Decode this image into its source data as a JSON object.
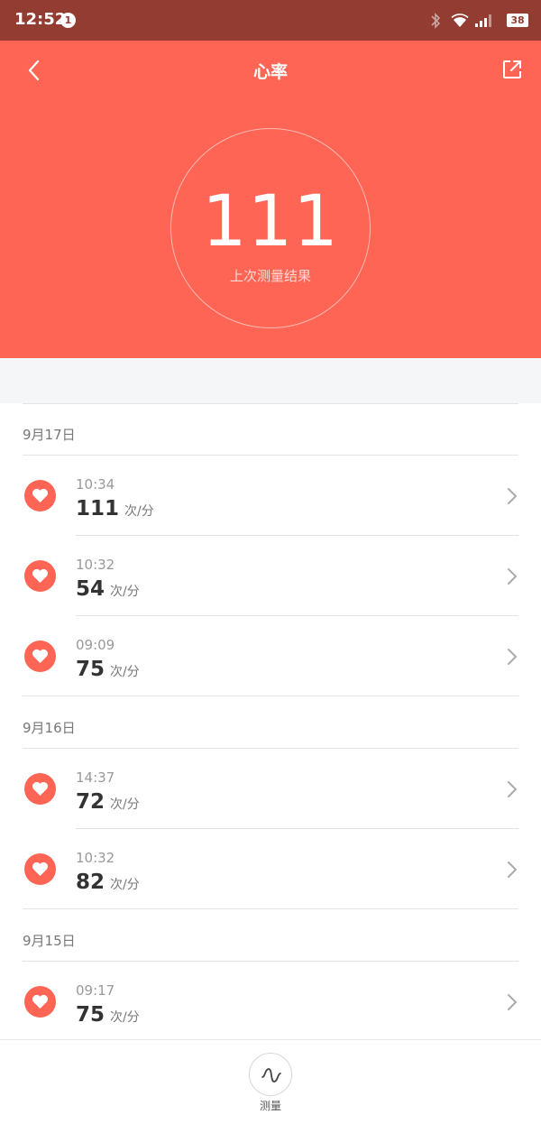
{
  "status_bar": {
    "time": "12:52",
    "notification_count": "1",
    "battery": "38"
  },
  "header": {
    "title": "心率",
    "value": "111",
    "caption": "上次测量结果"
  },
  "groups": [
    {
      "date": "9月17日",
      "items": [
        {
          "time": "10:34",
          "value": "111",
          "unit": "次/分"
        },
        {
          "time": "10:32",
          "value": "54",
          "unit": "次/分"
        },
        {
          "time": "09:09",
          "value": "75",
          "unit": "次/分"
        }
      ]
    },
    {
      "date": "9月16日",
      "items": [
        {
          "time": "14:37",
          "value": "72",
          "unit": "次/分"
        },
        {
          "time": "10:32",
          "value": "82",
          "unit": "次/分"
        }
      ]
    },
    {
      "date": "9月15日",
      "items": [
        {
          "time": "09:17",
          "value": "75",
          "unit": "次/分"
        }
      ]
    }
  ],
  "bottom": {
    "measure_label": "测量"
  },
  "colors": {
    "accent": "#ff6554",
    "status_bar": "#923c32",
    "divider": "#e4e4e4",
    "background_gap": "#f5f6f8"
  }
}
